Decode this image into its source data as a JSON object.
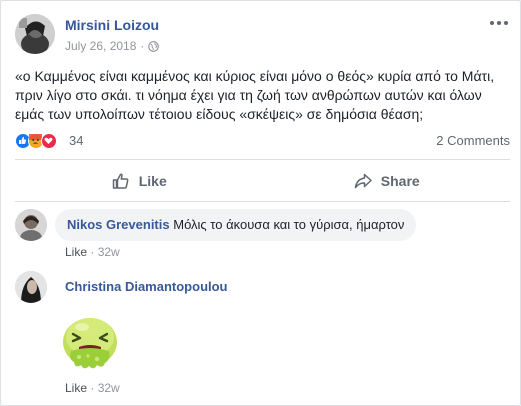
{
  "post": {
    "author": "Mirsini Loizou",
    "date": "July 26, 2018",
    "separator": "·",
    "text": "«ο Καμμένος είναι καμμένος και κύριος είναι μόνο ο θεός» κυρία από το Μάτι, πριν λίγο στο σκάι. τι νόημα έχει για τη ζωή των ανθρώπων αυτών και όλων εμάς των υπολοίπων τέτοιου είδους «σκέψεις» σε δημόσια θέαση;",
    "reaction_count": "34",
    "comments_count": "2 Comments",
    "like_label": "Like",
    "share_label": "Share",
    "reactions": [
      "like",
      "angry",
      "love"
    ]
  },
  "comments": [
    {
      "author": "Nikos Grevenitis",
      "text": "Μόλις το άκουσα και το γύρισα, ήμαρτον",
      "like_label": "Like",
      "separator": "·",
      "time": "32w"
    },
    {
      "author": "Christina Diamantopoulou",
      "sticker": "sick-emoji-sticker",
      "like_label": "Like",
      "separator": "·",
      "time": "32w"
    }
  ],
  "colors": {
    "link": "#365899",
    "meta": "#90949c",
    "like_blue": "#1877f2",
    "angry_orange": "#f5a623",
    "love_red": "#f0284a"
  }
}
